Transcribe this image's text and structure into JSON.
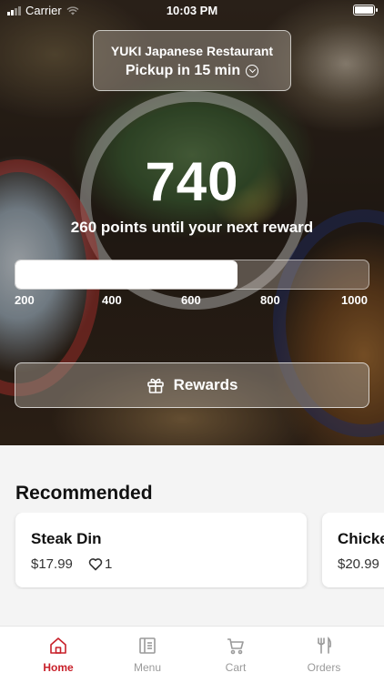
{
  "status_bar": {
    "carrier": "Carrier",
    "time": "10:03 PM"
  },
  "restaurant": {
    "name": "YUKI Japanese Restaurant",
    "pickup": "Pickup in 15 min"
  },
  "rewards": {
    "points": "740",
    "message": "260 points until your next reward",
    "progress_fraction": 0.63,
    "ticks": [
      "200",
      "400",
      "600",
      "800",
      "1000"
    ],
    "button_label": "Rewards"
  },
  "recommended": {
    "title": "Recommended",
    "items": [
      {
        "name": "Steak Din",
        "price": "$17.99",
        "likes": "1"
      },
      {
        "name": "Chicke",
        "price": "$20.99"
      }
    ]
  },
  "tabs": [
    {
      "label": "Home",
      "icon": "home-icon",
      "active": true
    },
    {
      "label": "Menu",
      "icon": "menu-icon",
      "active": false
    },
    {
      "label": "Cart",
      "icon": "cart-icon",
      "active": false
    },
    {
      "label": "Orders",
      "icon": "orders-icon",
      "active": false
    }
  ],
  "colors": {
    "accent": "#c8202a",
    "inactive_tab": "#9a9a9a"
  }
}
